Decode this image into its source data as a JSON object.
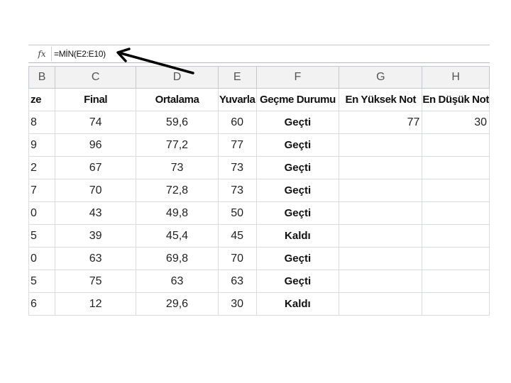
{
  "formula_bar": {
    "fx_label": "fx",
    "formula": "=MİN(E2:E10)"
  },
  "columns": [
    "B",
    "C",
    "D",
    "E",
    "F",
    "G",
    "H"
  ],
  "headers": {
    "b": "ze",
    "c": "Final",
    "d": "Ortalama",
    "e": "Yuvarla",
    "f": "Geçme Durumu",
    "g": "En Yüksek Not",
    "h": "En Düşük Not"
  },
  "rows": [
    {
      "b": "8",
      "c": "74",
      "d": "59,6",
      "e": "60",
      "f": "Geçti",
      "g": "77",
      "h": "30"
    },
    {
      "b": "9",
      "c": "96",
      "d": "77,2",
      "e": "77",
      "f": "Geçti",
      "g": "",
      "h": ""
    },
    {
      "b": "2",
      "c": "67",
      "d": "73",
      "e": "73",
      "f": "Geçti",
      "g": "",
      "h": ""
    },
    {
      "b": "7",
      "c": "70",
      "d": "72,8",
      "e": "73",
      "f": "Geçti",
      "g": "",
      "h": ""
    },
    {
      "b": "0",
      "c": "43",
      "d": "49,8",
      "e": "50",
      "f": "Geçti",
      "g": "",
      "h": ""
    },
    {
      "b": "5",
      "c": "39",
      "d": "45,4",
      "e": "45",
      "f": "Kaldı",
      "g": "",
      "h": ""
    },
    {
      "b": "0",
      "c": "63",
      "d": "69,8",
      "e": "70",
      "f": "Geçti",
      "g": "",
      "h": ""
    },
    {
      "b": "5",
      "c": "75",
      "d": "63",
      "e": "63",
      "f": "Geçti",
      "g": "",
      "h": ""
    },
    {
      "b": "6",
      "c": "12",
      "d": "29,6",
      "e": "30",
      "f": "Kaldı",
      "g": "",
      "h": ""
    }
  ]
}
